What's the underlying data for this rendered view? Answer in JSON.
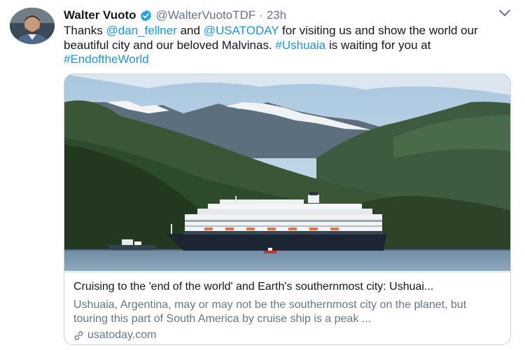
{
  "tweet": {
    "author_name": "Walter Vuoto",
    "author_handle": "@WalterVuotoTDF",
    "separator": "·",
    "time": "23h",
    "text": {
      "t1": "Thanks ",
      "mention1": "@dan_fellner",
      "t2": " and ",
      "mention2": "@USATODAY",
      "t3": " for visiting us and show the world our beautiful city and our beloved Malvinas. ",
      "hashtag1": "#Ushuaia",
      "t4": " is waiting for you at ",
      "hashtag2": "#EndoftheWorld"
    }
  },
  "card": {
    "title": "Cruising to the 'end of the world' and Earth's southernmost city: Ushuai...",
    "description": "Ushuaia, Argentina, may or may not be the southernmost city on the planet, but touring this part of South America by cruise ship is a peak ...",
    "domain": "usatoday.com"
  },
  "icons": {
    "verified": "verified-badge-icon",
    "caret": "chevron-down-icon",
    "link": "link-icon"
  },
  "colors": {
    "link": "#1b95e0",
    "verified": "#1da1f2",
    "secondary_text": "#657786",
    "border": "#ccd6dd"
  }
}
